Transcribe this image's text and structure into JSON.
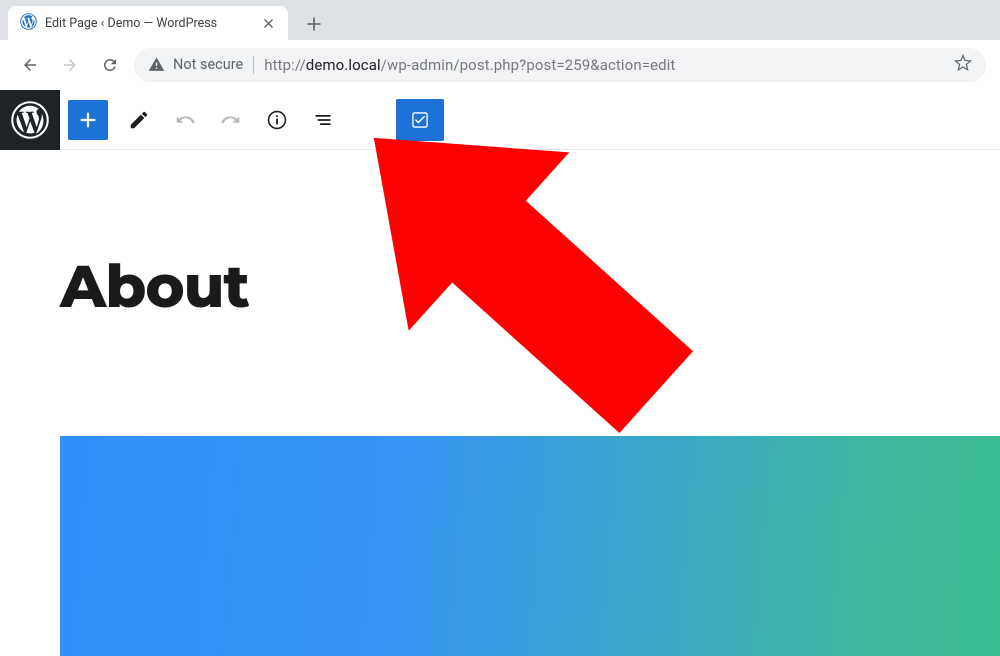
{
  "browser": {
    "tab_title": "Edit Page ‹ Demo — WordPress",
    "security_label": "Not secure",
    "url_protocol": "http://",
    "url_host": "demo.local",
    "url_path": "/wp-admin/post.php?post=259&action=edit"
  },
  "editor": {
    "page_title": "About"
  }
}
